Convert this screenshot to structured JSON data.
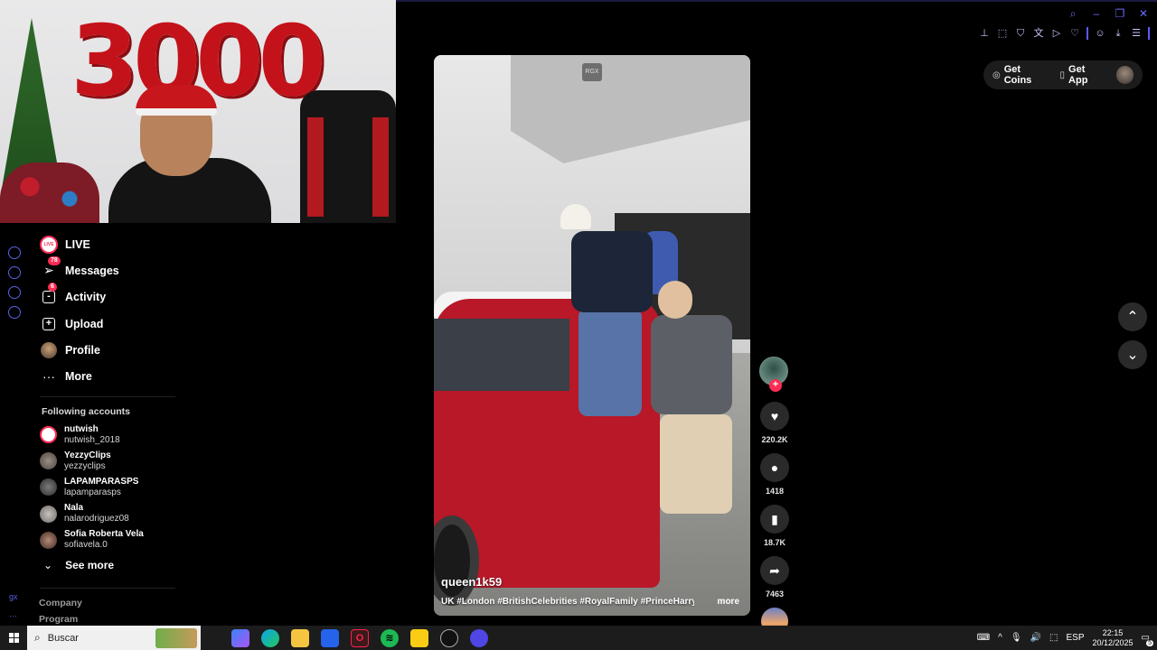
{
  "webcam": {
    "balloon_number": "3000"
  },
  "nav": {
    "items": [
      {
        "label": "LIVE",
        "icon": "live-icon",
        "icon_text": "LIVE"
      },
      {
        "label": "Messages",
        "icon": "messages-icon",
        "badge": "78"
      },
      {
        "label": "Activity",
        "icon": "activity-icon",
        "badge": "6"
      },
      {
        "label": "Upload",
        "icon": "upload-icon"
      },
      {
        "label": "Profile",
        "icon": "profile-icon"
      },
      {
        "label": "More",
        "icon": "more-icon"
      }
    ]
  },
  "following": {
    "title": "Following accounts",
    "accounts": [
      {
        "name": "nutwish",
        "handle": "nutwish_2018"
      },
      {
        "name": "YezzyClips",
        "handle": "yezzyclips"
      },
      {
        "name": "LAPAMPARASPS",
        "handle": "lapamparasps"
      },
      {
        "name": "Nala",
        "handle": "nalarodriguez08"
      },
      {
        "name": "Sofia Roberta Vela",
        "handle": "sofiavela.0"
      }
    ],
    "see_more": "See more"
  },
  "footer": {
    "company": "Company",
    "program": "Program"
  },
  "rail": {
    "bottom_text": "gx"
  },
  "video": {
    "watermark": "RGX",
    "username": "queen1k59",
    "caption": "UK #London #BritishCelebrities #RoyalFamily #PrinceHarry ...",
    "more": "more"
  },
  "actions": {
    "likes": "220.2K",
    "comments": "1418",
    "saves": "18.7K",
    "shares": "7463"
  },
  "header": {
    "get_coins": "Get Coins",
    "get_app": "Get App"
  },
  "taskbar": {
    "search_placeholder": "Buscar",
    "language": "ESP",
    "time": "22:15",
    "date": "20/12/2025",
    "notifications": "5"
  }
}
